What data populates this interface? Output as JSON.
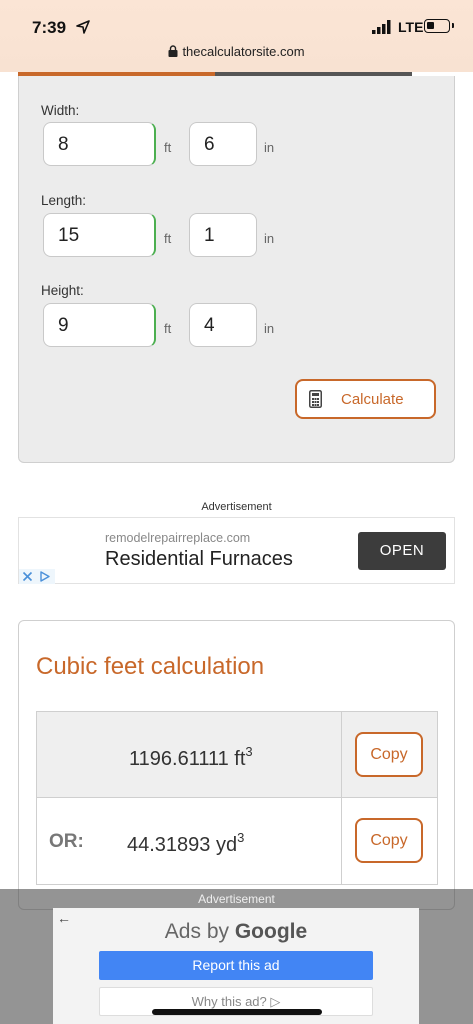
{
  "status_bar": {
    "time": "7:39",
    "network": "LTE",
    "url": "thecalculatorsite.com"
  },
  "form": {
    "width": {
      "label": "Width:",
      "ft_value": "8",
      "in_value": "6"
    },
    "length": {
      "label": "Length:",
      "ft_value": "15",
      "in_value": "1"
    },
    "height": {
      "label": "Height:",
      "ft_value": "9",
      "in_value": "4"
    },
    "units": {
      "ft": "ft",
      "in": "in"
    },
    "calculate_label": "Calculate"
  },
  "ad_banner": {
    "label": "Advertisement",
    "domain": "remodelrepairreplace.com",
    "title": "Residential Furnaces",
    "cta": "OPEN"
  },
  "result": {
    "title": "Cubic feet calculation",
    "primary_value": "1196.61111 ft",
    "primary_exp": "3",
    "or_label": "OR:",
    "secondary_value": "44.31893 yd",
    "secondary_exp": "3",
    "copy_label": "Copy"
  },
  "overlay_ad": {
    "label": "Advertisement",
    "ads_by": "Ads by",
    "google": "Google",
    "report": "Report this ad",
    "why": "Why this ad? ▷"
  },
  "colors": {
    "accent": "#c8682a",
    "google_blue": "#4285f4"
  },
  "icons": [
    "location-arrow-icon",
    "signal-icon",
    "battery-icon",
    "lock-icon",
    "calculator-icon",
    "ad-close-icon",
    "ad-choices-icon",
    "back-arrow-icon"
  ]
}
